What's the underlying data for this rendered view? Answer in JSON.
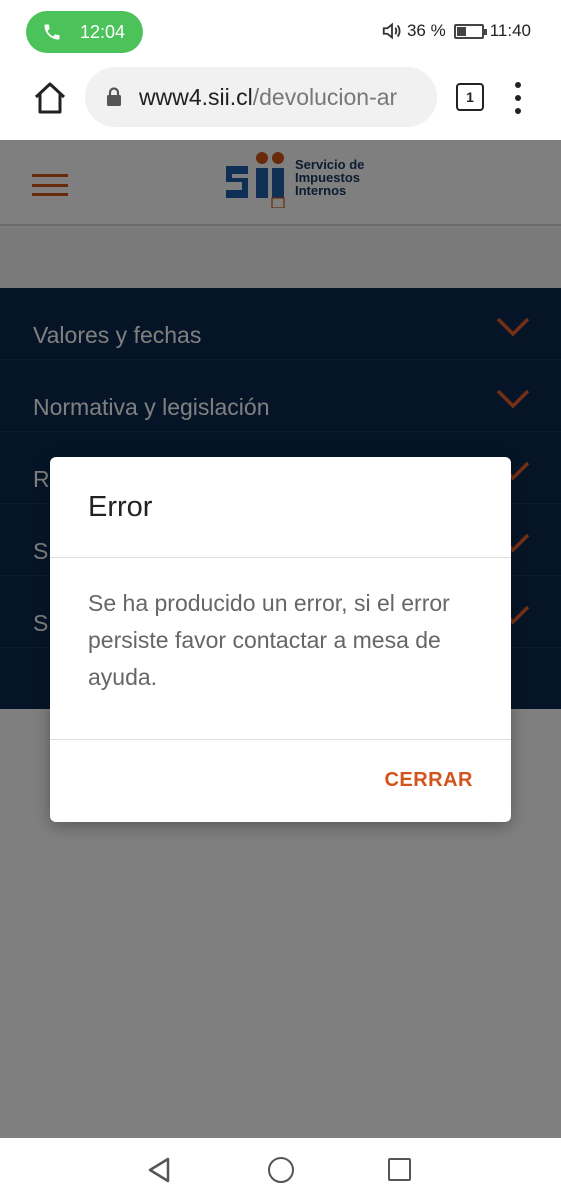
{
  "status_bar": {
    "call_time": "12:04",
    "battery_text": "36 %",
    "battery_level": 0.36,
    "clock": "11:40"
  },
  "browser": {
    "url_host": "www4.sii.cl",
    "url_path": "/devolucion-ar",
    "tab_count": "1"
  },
  "site": {
    "logo_text": [
      "Servicio de",
      "Impuestos",
      "Internos"
    ],
    "accent_color": "#d3531b",
    "menu_items": [
      {
        "label": "Valores y fechas"
      },
      {
        "label": "Normativa y legislación"
      },
      {
        "label": "R"
      },
      {
        "label": "S"
      },
      {
        "label": "S"
      }
    ]
  },
  "modal": {
    "title": "Error",
    "message": "Se ha producido un error, si el error persiste favor contactar a mesa de ayuda.",
    "close_label": "CERRAR"
  }
}
